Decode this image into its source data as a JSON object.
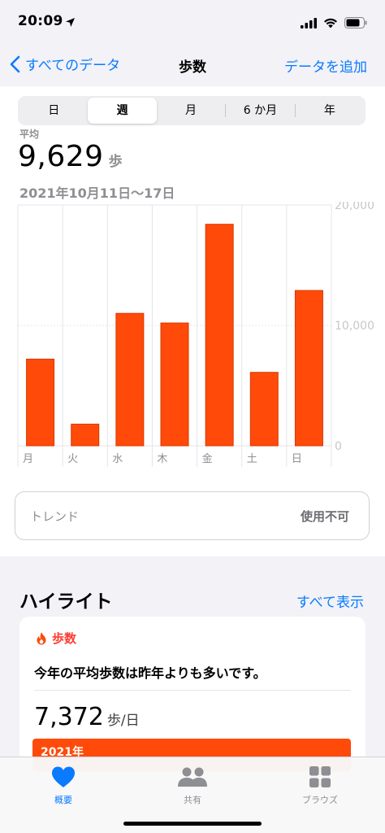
{
  "status": {
    "time": "20:09"
  },
  "nav": {
    "back_label": "すべてのデータ",
    "title": "歩数",
    "add_label": "データを追加"
  },
  "segments": [
    {
      "label": "日",
      "active": false
    },
    {
      "label": "週",
      "active": true
    },
    {
      "label": "月",
      "active": false
    },
    {
      "label": "6 か月",
      "active": false
    },
    {
      "label": "年",
      "active": false
    }
  ],
  "summary": {
    "label": "平均",
    "value": "9,629",
    "unit": "歩",
    "range": "2021年10月11日〜17日"
  },
  "chart_data": {
    "type": "bar",
    "categories": [
      "月",
      "火",
      "水",
      "木",
      "金",
      "土",
      "日"
    ],
    "values": [
      7200,
      1800,
      11000,
      10200,
      18400,
      6100,
      12900
    ],
    "ylim": [
      0,
      20000
    ],
    "yticks": [
      0,
      10000,
      20000
    ],
    "ytick_labels": [
      "0",
      "10,000",
      "20,000"
    ],
    "bar_color": "#ff4a0a",
    "grid": true
  },
  "trend": {
    "label": "トレンド",
    "value": "使用不可"
  },
  "highlights": {
    "title": "ハイライト",
    "show_all": "すべて表示",
    "card": {
      "category": "歩数",
      "text": "今年の平均歩数は昨年よりも多いです。",
      "value": "7,372",
      "unit": "歩/日",
      "bar_label": "2021年"
    }
  },
  "tabs": [
    {
      "label": "概要",
      "icon": "heart-icon",
      "active": true
    },
    {
      "label": "共有",
      "icon": "people-icon",
      "active": false
    },
    {
      "label": "ブラウズ",
      "icon": "grid-icon",
      "active": false
    }
  ],
  "colors": {
    "accent": "#0a7aff",
    "bar": "#ff4a0a",
    "inactive": "#8e8e93"
  }
}
